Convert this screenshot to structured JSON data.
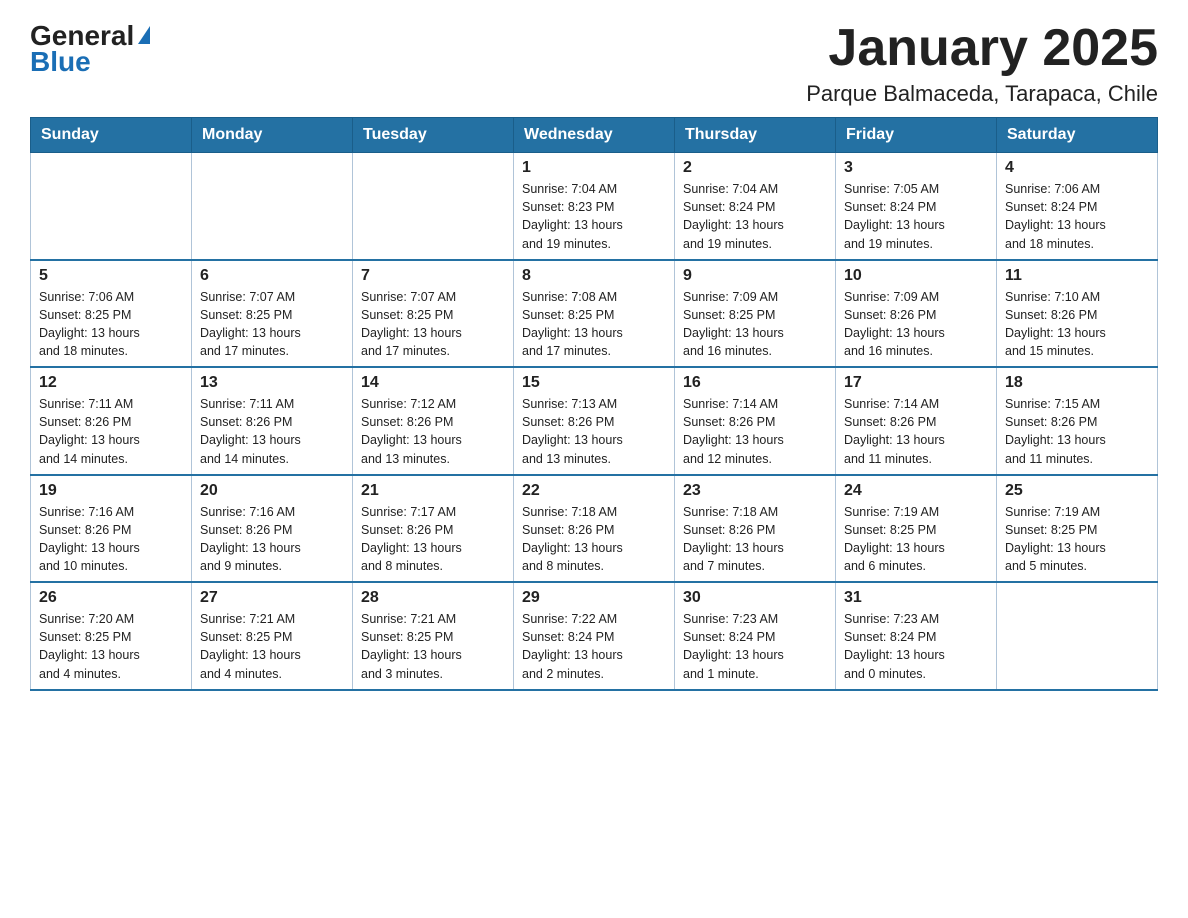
{
  "header": {
    "logo_general": "General",
    "logo_blue": "Blue",
    "title": "January 2025",
    "subtitle": "Parque Balmaceda, Tarapaca, Chile"
  },
  "days_of_week": [
    "Sunday",
    "Monday",
    "Tuesday",
    "Wednesday",
    "Thursday",
    "Friday",
    "Saturday"
  ],
  "weeks": [
    [
      {
        "day": "",
        "info": ""
      },
      {
        "day": "",
        "info": ""
      },
      {
        "day": "",
        "info": ""
      },
      {
        "day": "1",
        "info": "Sunrise: 7:04 AM\nSunset: 8:23 PM\nDaylight: 13 hours\nand 19 minutes."
      },
      {
        "day": "2",
        "info": "Sunrise: 7:04 AM\nSunset: 8:24 PM\nDaylight: 13 hours\nand 19 minutes."
      },
      {
        "day": "3",
        "info": "Sunrise: 7:05 AM\nSunset: 8:24 PM\nDaylight: 13 hours\nand 19 minutes."
      },
      {
        "day": "4",
        "info": "Sunrise: 7:06 AM\nSunset: 8:24 PM\nDaylight: 13 hours\nand 18 minutes."
      }
    ],
    [
      {
        "day": "5",
        "info": "Sunrise: 7:06 AM\nSunset: 8:25 PM\nDaylight: 13 hours\nand 18 minutes."
      },
      {
        "day": "6",
        "info": "Sunrise: 7:07 AM\nSunset: 8:25 PM\nDaylight: 13 hours\nand 17 minutes."
      },
      {
        "day": "7",
        "info": "Sunrise: 7:07 AM\nSunset: 8:25 PM\nDaylight: 13 hours\nand 17 minutes."
      },
      {
        "day": "8",
        "info": "Sunrise: 7:08 AM\nSunset: 8:25 PM\nDaylight: 13 hours\nand 17 minutes."
      },
      {
        "day": "9",
        "info": "Sunrise: 7:09 AM\nSunset: 8:25 PM\nDaylight: 13 hours\nand 16 minutes."
      },
      {
        "day": "10",
        "info": "Sunrise: 7:09 AM\nSunset: 8:26 PM\nDaylight: 13 hours\nand 16 minutes."
      },
      {
        "day": "11",
        "info": "Sunrise: 7:10 AM\nSunset: 8:26 PM\nDaylight: 13 hours\nand 15 minutes."
      }
    ],
    [
      {
        "day": "12",
        "info": "Sunrise: 7:11 AM\nSunset: 8:26 PM\nDaylight: 13 hours\nand 14 minutes."
      },
      {
        "day": "13",
        "info": "Sunrise: 7:11 AM\nSunset: 8:26 PM\nDaylight: 13 hours\nand 14 minutes."
      },
      {
        "day": "14",
        "info": "Sunrise: 7:12 AM\nSunset: 8:26 PM\nDaylight: 13 hours\nand 13 minutes."
      },
      {
        "day": "15",
        "info": "Sunrise: 7:13 AM\nSunset: 8:26 PM\nDaylight: 13 hours\nand 13 minutes."
      },
      {
        "day": "16",
        "info": "Sunrise: 7:14 AM\nSunset: 8:26 PM\nDaylight: 13 hours\nand 12 minutes."
      },
      {
        "day": "17",
        "info": "Sunrise: 7:14 AM\nSunset: 8:26 PM\nDaylight: 13 hours\nand 11 minutes."
      },
      {
        "day": "18",
        "info": "Sunrise: 7:15 AM\nSunset: 8:26 PM\nDaylight: 13 hours\nand 11 minutes."
      }
    ],
    [
      {
        "day": "19",
        "info": "Sunrise: 7:16 AM\nSunset: 8:26 PM\nDaylight: 13 hours\nand 10 minutes."
      },
      {
        "day": "20",
        "info": "Sunrise: 7:16 AM\nSunset: 8:26 PM\nDaylight: 13 hours\nand 9 minutes."
      },
      {
        "day": "21",
        "info": "Sunrise: 7:17 AM\nSunset: 8:26 PM\nDaylight: 13 hours\nand 8 minutes."
      },
      {
        "day": "22",
        "info": "Sunrise: 7:18 AM\nSunset: 8:26 PM\nDaylight: 13 hours\nand 8 minutes."
      },
      {
        "day": "23",
        "info": "Sunrise: 7:18 AM\nSunset: 8:26 PM\nDaylight: 13 hours\nand 7 minutes."
      },
      {
        "day": "24",
        "info": "Sunrise: 7:19 AM\nSunset: 8:25 PM\nDaylight: 13 hours\nand 6 minutes."
      },
      {
        "day": "25",
        "info": "Sunrise: 7:19 AM\nSunset: 8:25 PM\nDaylight: 13 hours\nand 5 minutes."
      }
    ],
    [
      {
        "day": "26",
        "info": "Sunrise: 7:20 AM\nSunset: 8:25 PM\nDaylight: 13 hours\nand 4 minutes."
      },
      {
        "day": "27",
        "info": "Sunrise: 7:21 AM\nSunset: 8:25 PM\nDaylight: 13 hours\nand 4 minutes."
      },
      {
        "day": "28",
        "info": "Sunrise: 7:21 AM\nSunset: 8:25 PM\nDaylight: 13 hours\nand 3 minutes."
      },
      {
        "day": "29",
        "info": "Sunrise: 7:22 AM\nSunset: 8:24 PM\nDaylight: 13 hours\nand 2 minutes."
      },
      {
        "day": "30",
        "info": "Sunrise: 7:23 AM\nSunset: 8:24 PM\nDaylight: 13 hours\nand 1 minute."
      },
      {
        "day": "31",
        "info": "Sunrise: 7:23 AM\nSunset: 8:24 PM\nDaylight: 13 hours\nand 0 minutes."
      },
      {
        "day": "",
        "info": ""
      }
    ]
  ]
}
